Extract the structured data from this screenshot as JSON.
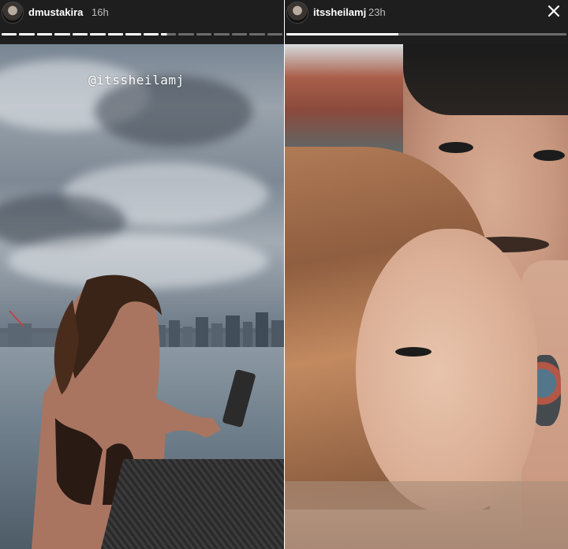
{
  "stories": [
    {
      "username": "dmustakira",
      "time_ago": "16h",
      "sticker_text": "@itssheilamj"
    },
    {
      "username": "itssheilamj",
      "time_ago": "23h"
    }
  ],
  "icons": {
    "close": "close-icon",
    "avatar": "avatar"
  },
  "colors": {
    "header_bg": "#1e1e1e",
    "progress_active": "#ffffff"
  }
}
